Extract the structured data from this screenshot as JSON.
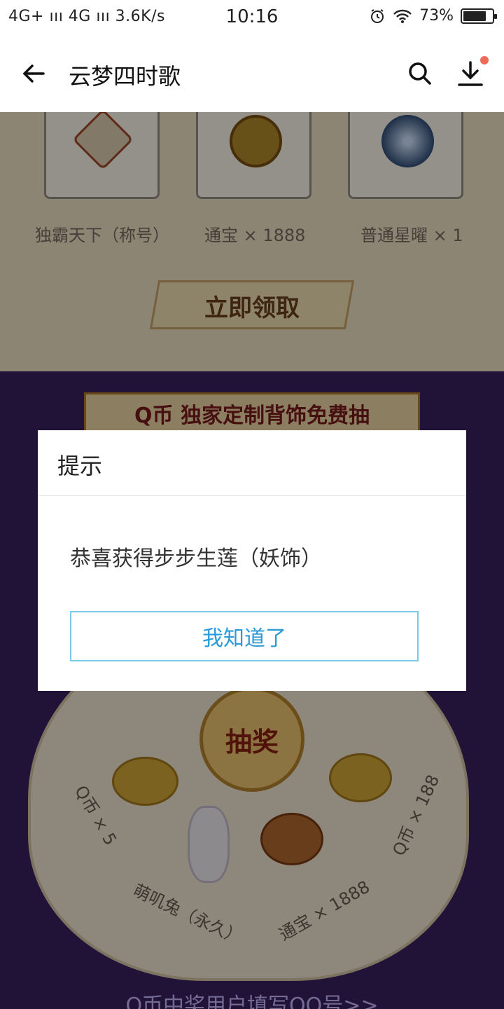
{
  "status_bar": {
    "network": "4G+ ııı 4G ııı 3.6K/s",
    "time": "10:16",
    "battery": "73%"
  },
  "header": {
    "title": "云梦四时歌",
    "notification_dot_color": "#f06a5a"
  },
  "background": {
    "prizes": [
      {
        "label": "独霸天下（称号）",
        "icon": "title-badge-icon"
      },
      {
        "label": "通宝 × 1888",
        "icon": "coins-icon"
      },
      {
        "label": "普通星曜 × 1",
        "icon": "star-orb-icon"
      }
    ],
    "claim_button": "立即领取",
    "banner": "Q币  独家定制背饰免费抽",
    "wheel_center": "抽奖",
    "wheel_segments": [
      "Q币 × 5",
      "萌叽兔（永久）",
      "通宝 × 1888",
      "Q币 × 188"
    ],
    "bottom_link": "Q币中奖用户填写QQ号>>"
  },
  "dialog": {
    "title": "提示",
    "message": "恭喜获得步步生莲（妖饰）",
    "button": "我知道了"
  }
}
